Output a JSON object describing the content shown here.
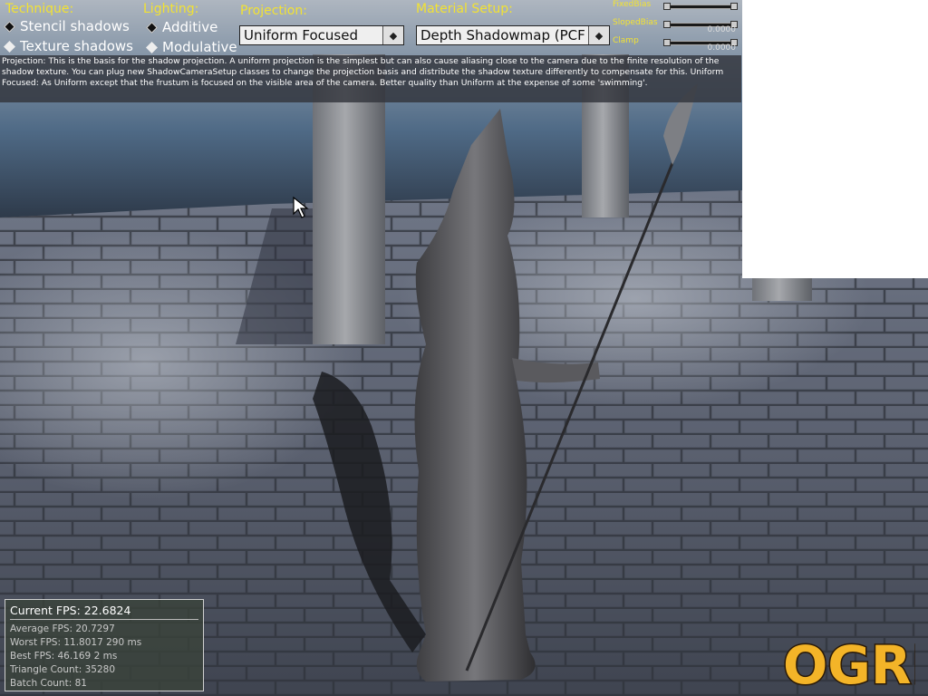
{
  "technique": {
    "heading": "Technique:",
    "options": [
      {
        "label": "Stencil shadows",
        "selected": false
      },
      {
        "label": "Texture shadows",
        "selected": true
      }
    ]
  },
  "lighting": {
    "heading": "Lighting:",
    "options": [
      {
        "label": "Additive",
        "selected": false
      },
      {
        "label": "Modulative",
        "selected": true
      }
    ]
  },
  "projection": {
    "heading": "Projection:",
    "selected": "Uniform Focused"
  },
  "material": {
    "heading": "Material Setup:",
    "selected": "Depth Shadowmap (PCF"
  },
  "sliders": [
    {
      "label": "FixedBias",
      "value": ""
    },
    {
      "label": "SlopedBias",
      "value": "0.0000"
    },
    {
      "label": "Clamp",
      "value": "0.0000"
    }
  ],
  "description": "Projection: This is the basis for the shadow projection. A uniform projection is the simplest but can also cause aliasing close to the camera due to the finite resolution of the shadow texture. You can plug new ShadowCameraSetup classes to change the projection basis and distribute the shadow texture differently to compensate for this. Uniform Focused: As Uniform except that the frustum is focused on the visible area of the camera. Better quality than Uniform at the expense of some 'swimming'.",
  "stats": {
    "current": "Current  FPS:  22.6824",
    "average": "Average  FPS:  20.7297",
    "worst": "Worst  FPS:  11.8017  290  ms",
    "best": "Best  FPS:  46.169  2  ms",
    "triangles": "Triangle  Count:  35280",
    "batches": "Batch  Count:  81"
  },
  "logo": "OGRE",
  "icons": {
    "radio_off": "hollow-diamond-icon",
    "radio_on": "filled-diamond-icon",
    "dropdown": "dropdown-arrow-icon",
    "cursor": "mouse-pointer-icon"
  },
  "colors": {
    "heading": "#f2e233",
    "logo_fill": "#f3b428"
  }
}
